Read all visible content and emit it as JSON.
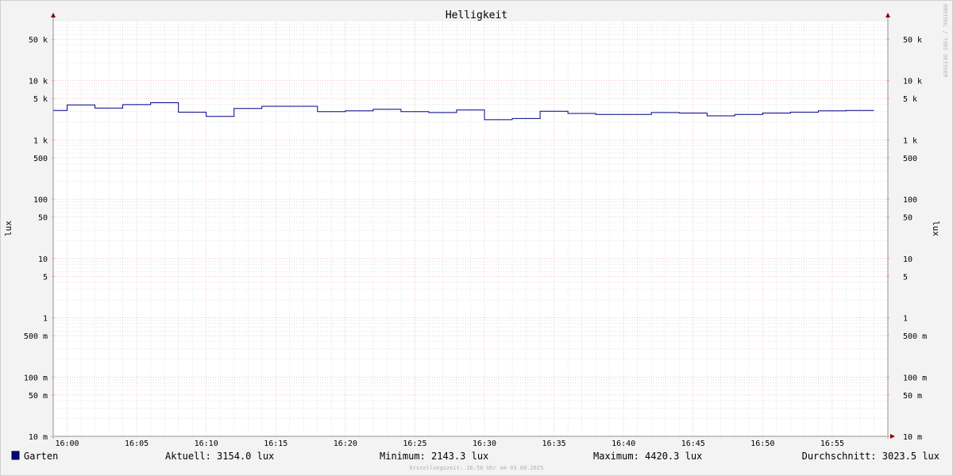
{
  "chart_data": {
    "type": "line",
    "title": "Helligkeit",
    "ylabel": "lux",
    "y_scale": "log",
    "ylim": [
      0.01,
      100000
    ],
    "xlim": [
      "15:59",
      "16:59"
    ],
    "x_ticks": [
      "16:00",
      "16:05",
      "16:10",
      "16:15",
      "16:20",
      "16:25",
      "16:30",
      "16:35",
      "16:40",
      "16:45",
      "16:50",
      "16:55"
    ],
    "y_ticks": [
      {
        "value": 50000,
        "label": "50 k"
      },
      {
        "value": 10000,
        "label": "10 k"
      },
      {
        "value": 5000,
        "label": "5 k"
      },
      {
        "value": 1000,
        "label": "1 k"
      },
      {
        "value": 500,
        "label": "500"
      },
      {
        "value": 100,
        "label": "100"
      },
      {
        "value": 50,
        "label": "50"
      },
      {
        "value": 10,
        "label": "10"
      },
      {
        "value": 5,
        "label": "5"
      },
      {
        "value": 1,
        "label": "1"
      },
      {
        "value": 0.5,
        "label": "500 m"
      },
      {
        "value": 0.1,
        "label": "100 m"
      },
      {
        "value": 0.05,
        "label": "50 m"
      },
      {
        "value": 0.01,
        "label": "10 m"
      }
    ],
    "grid": true,
    "series": [
      {
        "name": "Garten",
        "color": "#00008b",
        "step": true,
        "x": [
          "15:58",
          "16:00",
          "16:02",
          "16:04",
          "16:06",
          "16:08",
          "16:10",
          "16:12",
          "16:14",
          "16:16",
          "16:18",
          "16:20",
          "16:22",
          "16:24",
          "16:26",
          "16:28",
          "16:30",
          "16:32",
          "16:34",
          "16:36",
          "16:38",
          "16:40",
          "16:42",
          "16:44",
          "16:46",
          "16:48",
          "16:50",
          "16:52",
          "16:54",
          "16:56",
          "16:58"
        ],
        "y": [
          2700,
          3150,
          3900,
          3450,
          3950,
          4250,
          2950,
          2500,
          3400,
          3700,
          3700,
          3000,
          3100,
          3300,
          3000,
          2900,
          3200,
          2200,
          2300,
          3050,
          2800,
          2700,
          2700,
          2900,
          2850,
          2550,
          2700,
          2850,
          2950,
          3100,
          3150
        ]
      }
    ]
  },
  "legend": {
    "series_name": "Garten",
    "swatch_color": "#00008b",
    "aktuell": "Aktuell: 3154.0 lux",
    "minimum": "Minimum: 2143.3 lux",
    "maximum": "Maximum: 4420.3 lux",
    "durchschnitt": "Durchschnitt: 3023.5 lux"
  },
  "footer": "Erstellungszeit: 16:58 Uhr am 03.08.2025",
  "watermark": "RRDTOOL / TOBI OETIKER",
  "colors": {
    "major_grid": "#f0a0a0",
    "minor_grid": "#c8c8c8",
    "axis": "#909090",
    "arrow": "#8b0000"
  }
}
